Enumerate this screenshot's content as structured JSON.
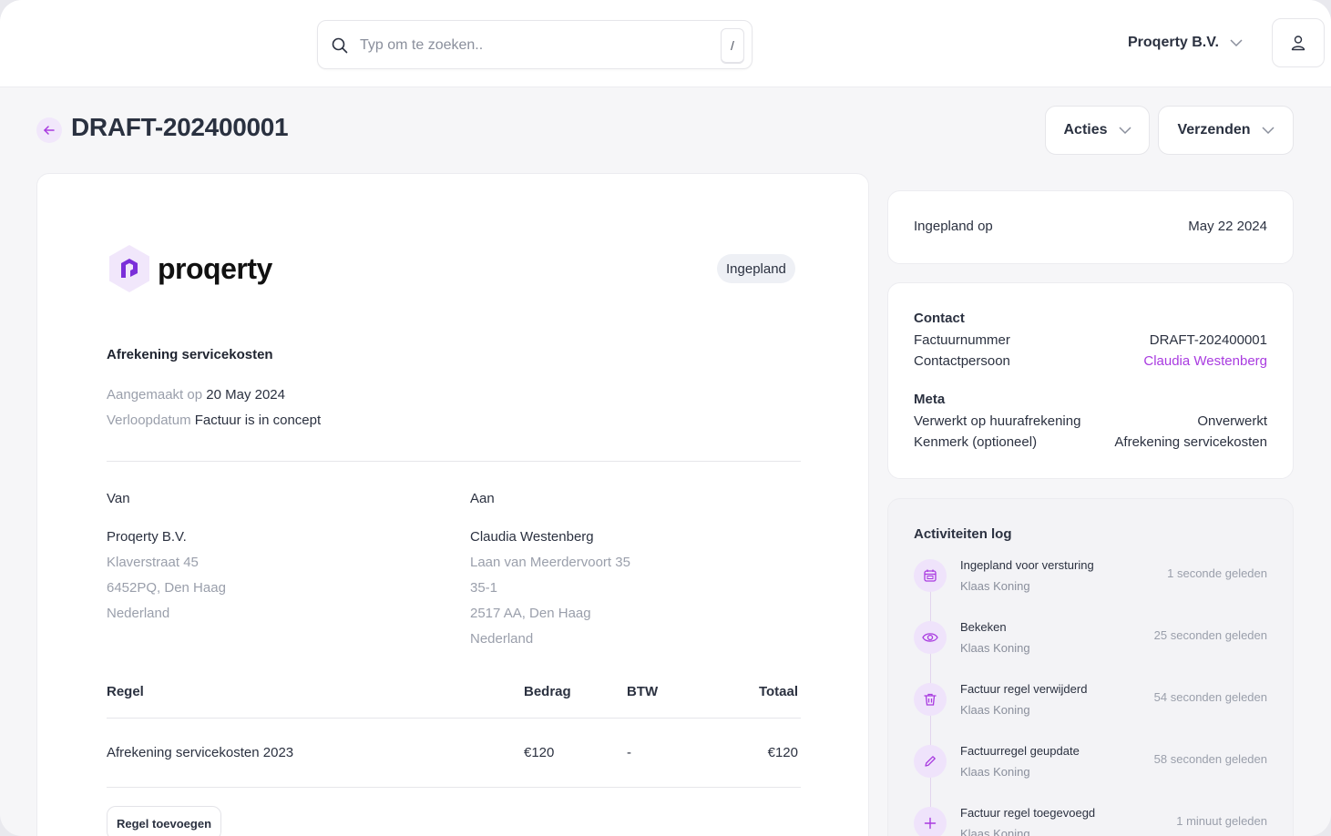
{
  "search": {
    "placeholder": "Typ om te zoeken..",
    "shortcut": "/"
  },
  "header": {
    "org_name": "Proqerty B.V."
  },
  "page": {
    "title": "DRAFT-202400001",
    "actions_label": "Acties",
    "send_label": "Verzenden"
  },
  "invoice": {
    "logo_text": "proqerty",
    "status": "Ingepland",
    "subject": "Afrekening servicekosten",
    "created_label": "Aangemaakt op",
    "created_value": "20 May 2024",
    "due_label": "Verloopdatum",
    "due_value": "Factuur is in concept",
    "from": {
      "label": "Van",
      "name": "Proqerty B.V.",
      "lines": [
        "Klaverstraat 45",
        "6452PQ, Den Haag",
        "Nederland"
      ]
    },
    "to": {
      "label": "Aan",
      "name": "Claudia Westenberg",
      "lines": [
        "Laan van Meerdervoort 35",
        "35-1",
        "2517 AA, Den Haag",
        "Nederland"
      ]
    },
    "table": {
      "headers": [
        "Regel",
        "Bedrag",
        "BTW",
        "Totaal"
      ],
      "rows": [
        [
          "Afrekening servicekosten 2023",
          "€120",
          "-",
          "€120"
        ]
      ]
    },
    "add_line_label": "Regel toevoegen"
  },
  "scheduled": {
    "label": "Ingepland op",
    "value": "May 22 2024"
  },
  "details": {
    "contact_title": "Contact",
    "invoice_number_label": "Factuurnummer",
    "invoice_number_value": "DRAFT-202400001",
    "contact_person_label": "Contactpersoon",
    "contact_person_value": "Claudia Westenberg",
    "meta_title": "Meta",
    "processed_label": "Verwerkt op huurafrekening",
    "processed_value": "Onverwerkt",
    "reference_label": "Kenmerk (optioneel)",
    "reference_value": "Afrekening servicekosten"
  },
  "activity": {
    "title": "Activiteiten log",
    "items": [
      {
        "icon": "calendar-icon",
        "action": "Ingepland voor versturing",
        "user": "Klaas Koning",
        "time": "1 seconde geleden"
      },
      {
        "icon": "eye-icon",
        "action": "Bekeken",
        "user": "Klaas Koning",
        "time": "25 seconden geleden"
      },
      {
        "icon": "trash-icon",
        "action": "Factuur regel verwijderd",
        "user": "Klaas Koning",
        "time": "54 seconden geleden"
      },
      {
        "icon": "pencil-icon",
        "action": "Factuurregel geupdate",
        "user": "Klaas Koning",
        "time": "58 seconden geleden"
      },
      {
        "icon": "plus-icon",
        "action": "Factuur regel toegevoegd",
        "user": "Klaas Koning",
        "time": "1 minuut geleden"
      }
    ]
  },
  "colors": {
    "accent": "#a93be0",
    "accent_soft": "#efe3fb",
    "background": "#f6f6f8"
  }
}
